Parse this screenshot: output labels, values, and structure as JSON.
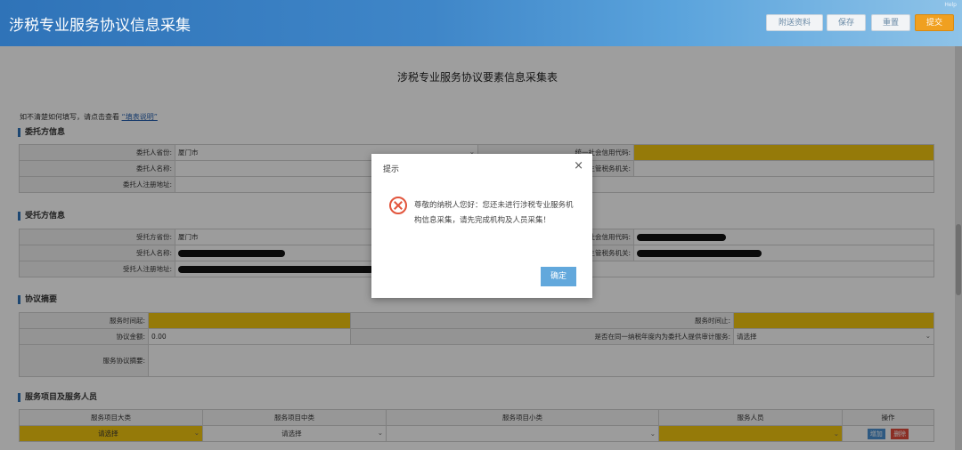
{
  "header": {
    "title": "涉税专业服务协议信息采集",
    "buttons": [
      "附送资料",
      "保存",
      "重置",
      "提交"
    ],
    "tiny": "Help"
  },
  "form": {
    "title": "涉税专业服务协议要素信息采集表",
    "hint_prefix": "如不清楚如何填写，请点击查看",
    "hint_link": "“填表说明”",
    "sections": {
      "client": "委托方信息",
      "agent": "受托方信息",
      "agreement": "协议摘要",
      "service": "服务项目及服务人员"
    },
    "client": {
      "province_label": "委托人省份:",
      "province_value": "厦门市",
      "credit_label": "统一社会信用代码:",
      "name_label": "委托人名称:",
      "tax_label": "主管税务机关:",
      "address_label": "委托人注册地址:"
    },
    "agent": {
      "province_label": "受托方省份:",
      "province_value": "厦门市",
      "credit_label": "统一社会信用代码:",
      "name_label": "受托人名称:",
      "tax_label": "主管税务机关:",
      "address_label": "受托人注册地址:"
    },
    "agreement": {
      "start_label": "服务时间起:",
      "end_label": "服务时间止:",
      "amount_label": "协议金额:",
      "amount_value": "0.00",
      "audit_label": "是否在同一纳税年度内为委托人提供审计服务:",
      "audit_value": "请选择",
      "summary_label": "服务协议摘要:"
    },
    "service": {
      "headers": [
        "服务项目大类",
        "服务项目中类",
        "服务项目小类",
        "服务人员",
        "操作"
      ],
      "major": "请选择",
      "middle": "请选择",
      "add": "增加",
      "delete": "删除"
    }
  },
  "dialog": {
    "title": "提示",
    "close": "×",
    "message": "尊敬的纳税人您好：您还未进行涉税专业服务机构信息采集，请先完成机构及人员采集！",
    "ok": "确定"
  },
  "colors": {
    "accent": "#2f73b8",
    "required": "#f1c40f",
    "submit": "#f0a020",
    "error": "#e2553c"
  }
}
